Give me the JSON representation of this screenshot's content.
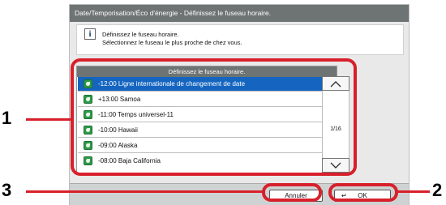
{
  "window": {
    "title": "Date/Temporisation/Éco d'énergie - Définissez le fuseau horaire."
  },
  "info": {
    "icon": "info-icon",
    "line1": "Définissez le fuseau horaire.",
    "line2": "Sélectionnez le fuseau le plus proche de chez vous."
  },
  "list": {
    "header": "Définissez le fuseau horaire.",
    "items": [
      {
        "label": "-12:00 Ligne internationale de changement de date",
        "selected": true
      },
      {
        "label": "+13:00 Samoa",
        "selected": false
      },
      {
        "label": "-11:00 Temps universel-11",
        "selected": false
      },
      {
        "label": "-10:00 Hawaii",
        "selected": false
      },
      {
        "label": "-09:00 Alaska",
        "selected": false
      },
      {
        "label": "-08:00 Baja California",
        "selected": false
      }
    ],
    "page_indicator": "1/16"
  },
  "buttons": {
    "cancel": "Annuler",
    "ok": "OK"
  },
  "callouts": {
    "one": "1",
    "two": "2",
    "three": "3"
  },
  "colors": {
    "callout_red": "#d7202b",
    "selected_row": "#1565c0",
    "header_gray": "#6e7373"
  }
}
